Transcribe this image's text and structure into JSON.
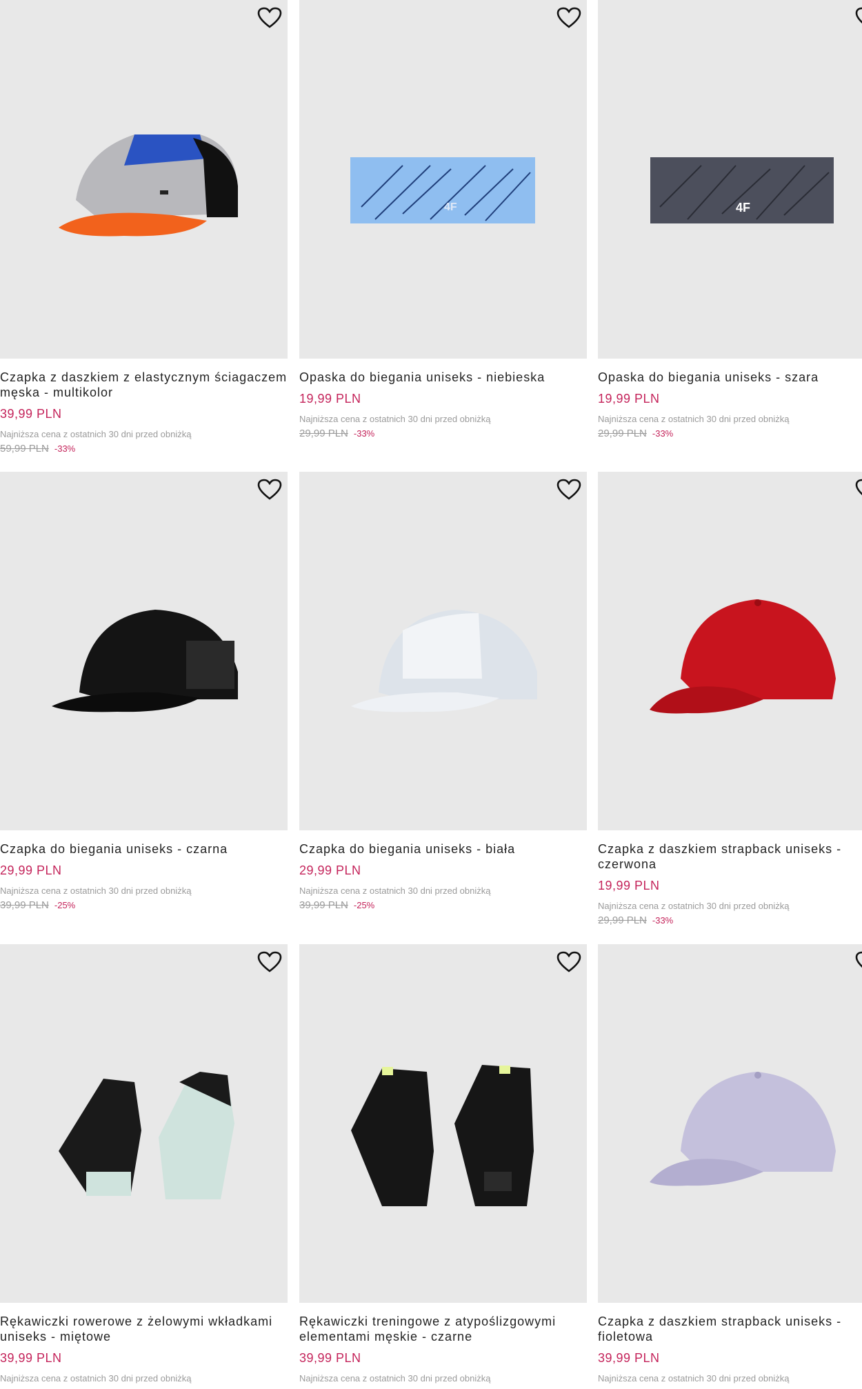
{
  "icons": {
    "favorite": "heart-outline-icon"
  },
  "colors": {
    "price": "#c4235a",
    "muted": "#9a9a9a",
    "image_bg": "#e8e8e8"
  },
  "products": [
    {
      "title": "Czapka z daszkiem z elastycznym ściagaczem męska - multikolor",
      "price": "39,99 PLN",
      "lowest_label": "Najniższa cena z ostatnich 30 dni przed obniżką",
      "old_price": "59,99 PLN",
      "discount": "-33%"
    },
    {
      "title": "Opaska do biegania uniseks - niebieska",
      "price": "19,99 PLN",
      "lowest_label": "Najniższa cena z ostatnich 30 dni przed obniżką",
      "old_price": "29,99 PLN",
      "discount": "-33%"
    },
    {
      "title": "Opaska do biegania uniseks - szara",
      "price": "19,99 PLN",
      "lowest_label": "Najniższa cena z ostatnich 30 dni przed obniżką",
      "old_price": "29,99 PLN",
      "discount": "-33%"
    },
    {
      "title": "Czapka do biegania uniseks - czarna",
      "price": "29,99 PLN",
      "lowest_label": "Najniższa cena z ostatnich 30 dni przed obniżką",
      "old_price": "39,99 PLN",
      "discount": "-25%"
    },
    {
      "title": "Czapka do biegania uniseks - biała",
      "price": "29,99 PLN",
      "lowest_label": "Najniższa cena z ostatnich 30 dni przed obniżką",
      "old_price": "39,99 PLN",
      "discount": "-25%"
    },
    {
      "title": "Czapka z daszkiem strapback uniseks - czerwona",
      "price": "19,99 PLN",
      "lowest_label": "Najniższa cena z ostatnich 30 dni przed obniżką",
      "old_price": "29,99 PLN",
      "discount": "-33%"
    },
    {
      "title": "Rękawiczki rowerowe z żelowymi wkładkami uniseks - miętowe",
      "price": "39,99 PLN",
      "lowest_label": "Najniższa cena z ostatnich 30 dni przed obniżką",
      "old_price": "",
      "discount": ""
    },
    {
      "title": "Rękawiczki treningowe z atypoślizgowymi elementami męskie - czarne",
      "price": "39,99 PLN",
      "lowest_label": "Najniższa cena z ostatnich 30 dni przed obniżką",
      "old_price": "",
      "discount": ""
    },
    {
      "title": "Czapka z daszkiem strapback uniseks - fioletowa",
      "price": "39,99 PLN",
      "lowest_label": "Najniższa cena z ostatnich 30 dni przed obniżką",
      "old_price": "",
      "discount": ""
    }
  ]
}
